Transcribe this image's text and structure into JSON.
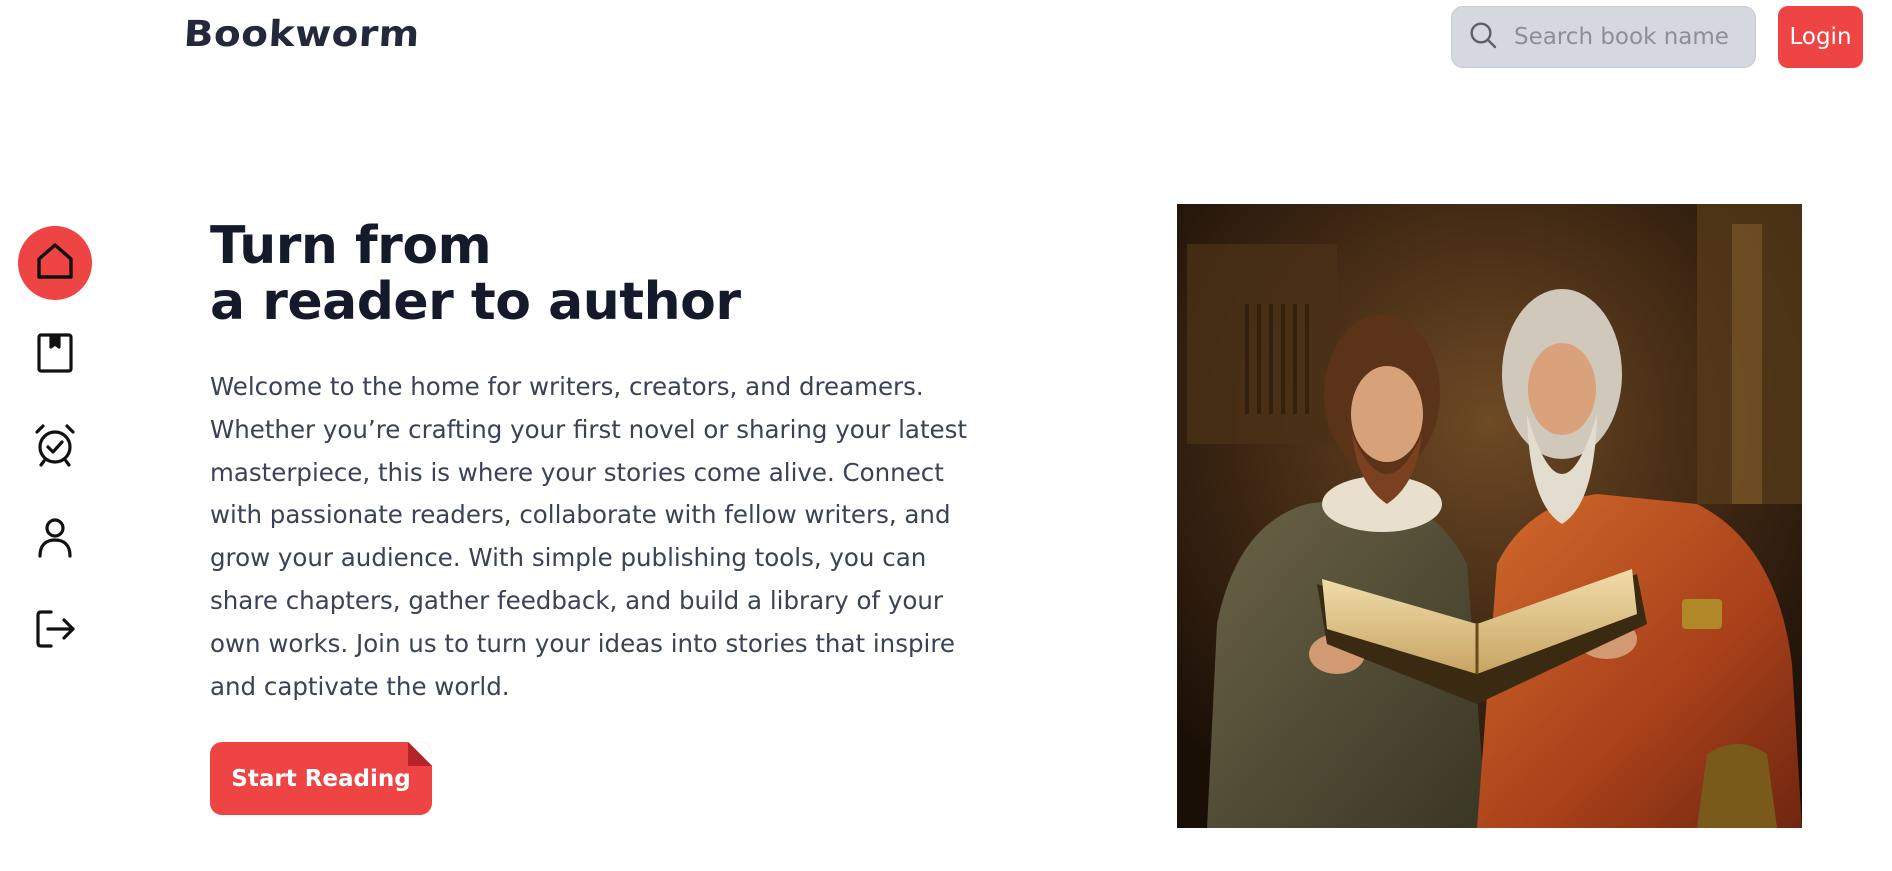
{
  "app": {
    "logo": "Bookworm"
  },
  "header": {
    "search_placeholder": "Search book name",
    "search_icon": "search-icon",
    "login_label": "Login"
  },
  "sidenav": {
    "items": [
      {
        "icon": "home-icon",
        "active": true
      },
      {
        "icon": "bookmark-icon",
        "active": false
      },
      {
        "icon": "alarm-clock-check-icon",
        "active": false
      },
      {
        "icon": "user-icon",
        "active": false
      },
      {
        "icon": "logout-icon",
        "active": false
      }
    ]
  },
  "hero": {
    "title_line1": "Turn from",
    "title_line2": "a reader to author",
    "description": "Welcome to the home for writers, creators, and dreamers. Whether you’re crafting your first novel or sharing your latest masterpiece, this is where your stories come alive. Connect with passionate readers, collaborate with fellow writers, and grow your audience. With simple publishing tools, you can share chapters, gather feedback, and build a library of your own works. Join us to turn your ideas into stories that inspire and captivate the world.",
    "cta_label": "Start Reading"
  },
  "colors": {
    "accent": "#ee4444",
    "heading": "#151a2b",
    "body_text": "#3a4254",
    "search_bg": "#d5d8df"
  }
}
